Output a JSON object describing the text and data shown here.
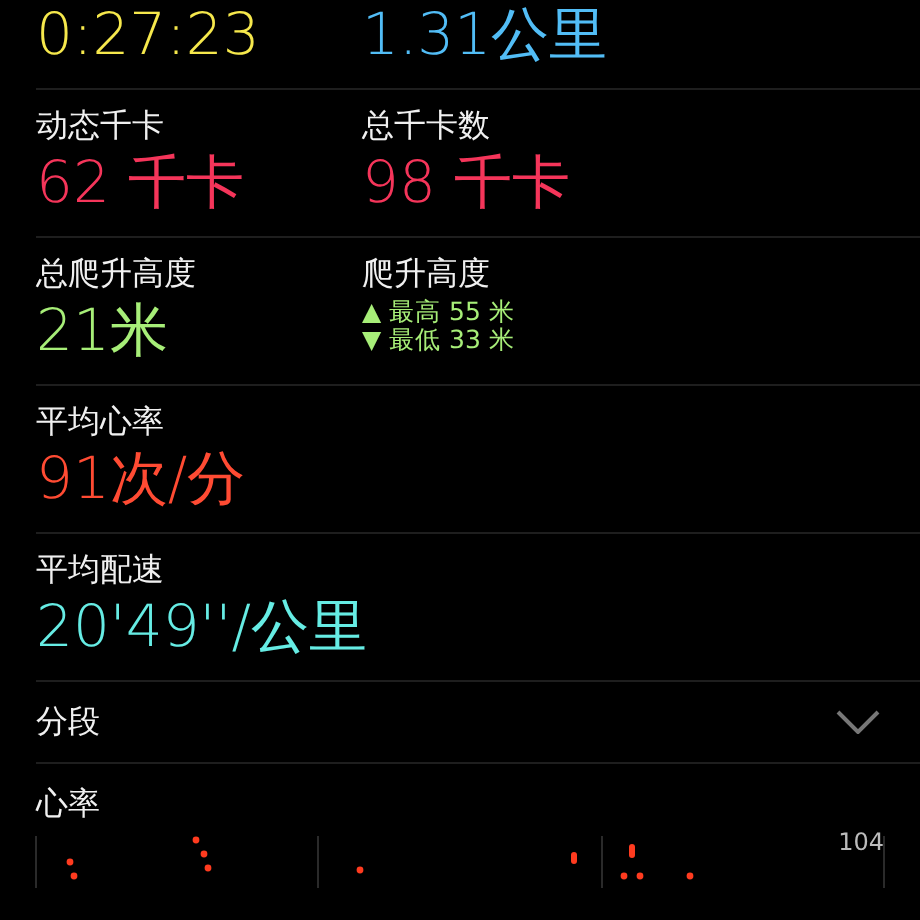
{
  "metric_rows": [
    {
      "cells": [
        {
          "kind": "value",
          "value": "0:27:23",
          "color": "#f6e84c"
        },
        {
          "kind": "value",
          "value": "1.31公里",
          "color": "#52bdf6"
        }
      ]
    },
    {
      "cells": [
        {
          "kind": "value",
          "label": "动态千卡",
          "value": "62 千卡",
          "color": "#f5355a"
        },
        {
          "kind": "value",
          "label": "总千卡数",
          "value": "98 千卡",
          "color": "#f5355a"
        }
      ]
    },
    {
      "cells": [
        {
          "kind": "value",
          "label": "总爬升高度",
          "value": "21米",
          "color": "#a7ee78"
        },
        {
          "kind": "range",
          "label": "爬升高度",
          "high": "▲ 最高 55 米",
          "low": "▼ 最低 33 米",
          "color": "#a7ee78"
        }
      ]
    },
    {
      "cells": [
        {
          "kind": "value",
          "label": "平均心率",
          "value": "91次/分",
          "color": "#ff4b33"
        }
      ]
    },
    {
      "cells": [
        {
          "kind": "value",
          "label": "平均配速",
          "value": "20'49''/公里",
          "color": "#66ece4"
        }
      ]
    }
  ],
  "splits": {
    "label": "分段",
    "expanded": false
  },
  "heart_rate": {
    "label": "心率",
    "max_label": "104"
  }
}
